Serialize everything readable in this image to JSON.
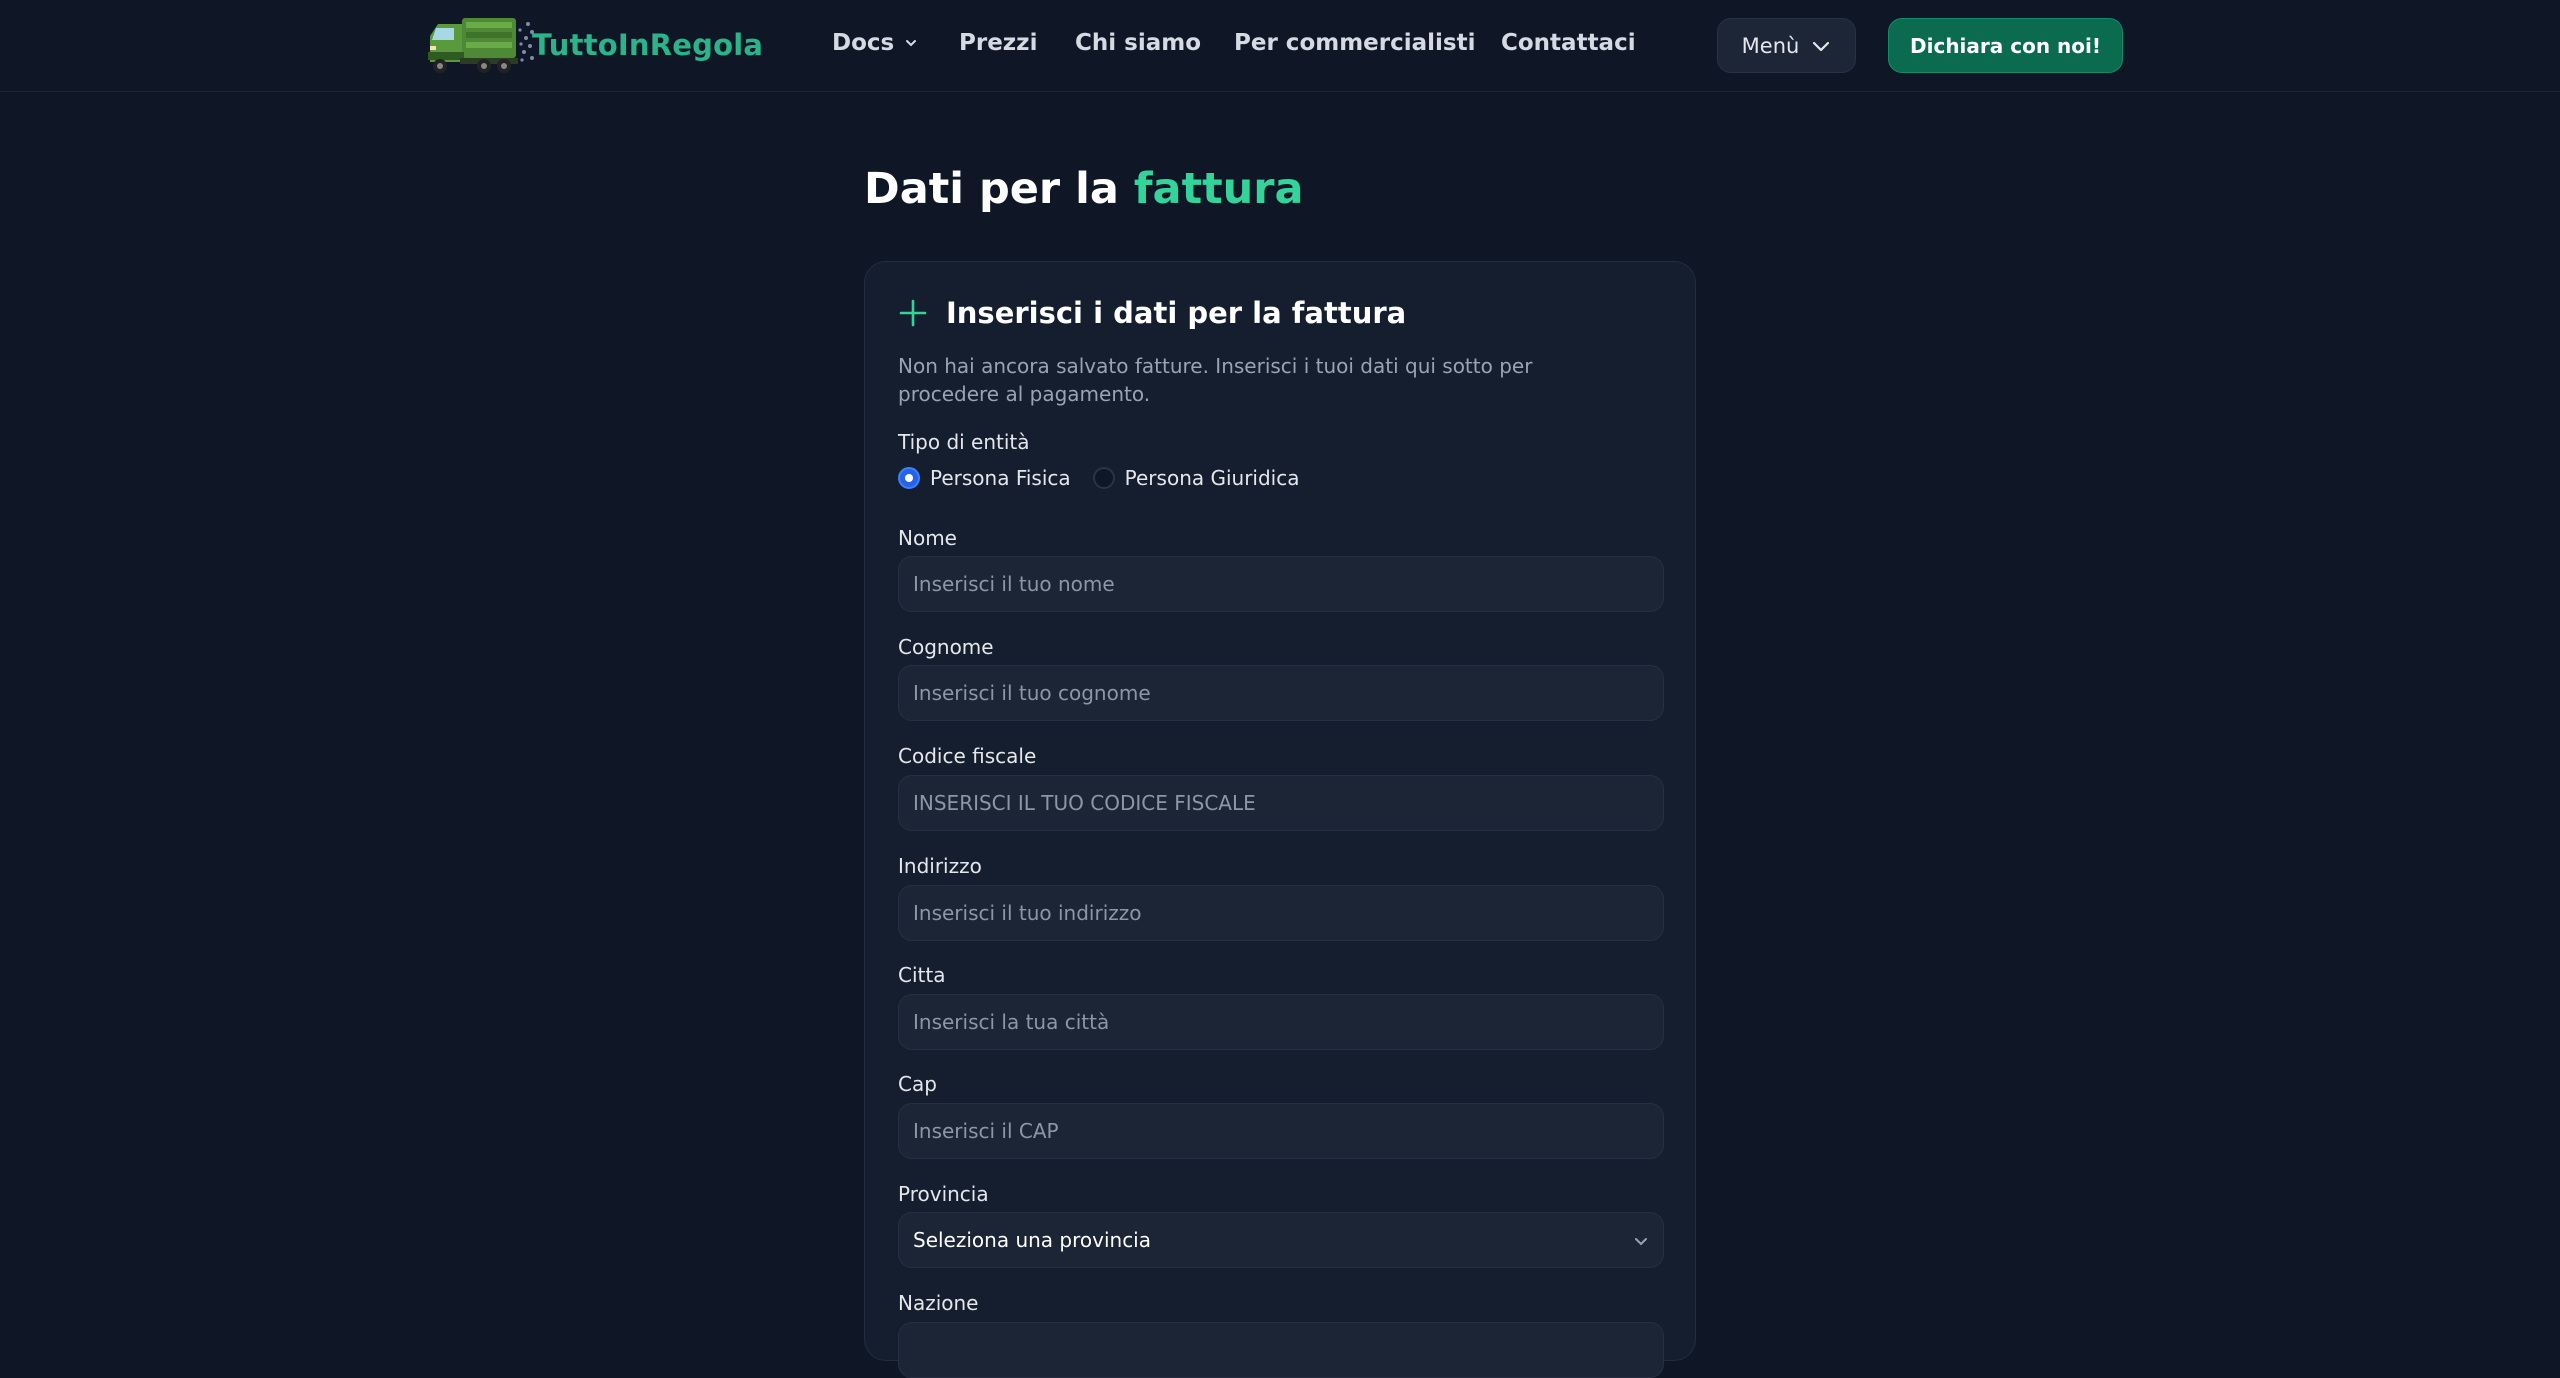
{
  "brand": {
    "name": "TuttoInRegola"
  },
  "nav": {
    "docs": "Docs",
    "prezzi": "Prezzi",
    "chi_siamo": "Chi siamo",
    "commercialisti": "Per commercialisti",
    "contattaci": "Contattaci"
  },
  "header": {
    "menu_label": "Menù",
    "cta_label": "Dichiara con noi!"
  },
  "page": {
    "title_prefix": "Dati per la",
    "title_accent": "fattura"
  },
  "card": {
    "title": "Inserisci i dati per la fattura",
    "description": "Non hai ancora salvato fatture. Inserisci i tuoi dati qui sotto per procedere al pagamento."
  },
  "form": {
    "entity_label": "Tipo di entità",
    "entity_options": [
      "Persona Fisica",
      "Persona Giuridica"
    ],
    "entity_selected": "Persona Fisica",
    "nome": {
      "label": "Nome",
      "placeholder": "Inserisci il tuo nome",
      "value": ""
    },
    "cognome": {
      "label": "Cognome",
      "placeholder": "Inserisci il tuo cognome",
      "value": ""
    },
    "codice_fiscale": {
      "label": "Codice fiscale",
      "placeholder": "INSERISCI IL TUO CODICE FISCALE",
      "value": ""
    },
    "indirizzo": {
      "label": "Indirizzo",
      "placeholder": "Inserisci il tuo indirizzo",
      "value": ""
    },
    "citta": {
      "label": "Citta",
      "placeholder": "Inserisci la tua città",
      "value": ""
    },
    "cap": {
      "label": "Cap",
      "placeholder": "Inserisci il CAP",
      "value": ""
    },
    "provincia": {
      "label": "Provincia",
      "selected": "Seleziona una provincia"
    },
    "nazione": {
      "label": "Nazione"
    }
  },
  "colors": {
    "background": "#0f1727",
    "card": "#141e2e",
    "accent": "#34d399",
    "brand_green": "#2bb489",
    "cta": "#0b6b4f",
    "radio_checked": "#2563eb"
  },
  "icons": {
    "logo": "green-truck-logo",
    "docs_chevron": "chevron-down-icon",
    "menu_chevron": "chevron-down-icon",
    "card_icon": "plus-icon",
    "select_chevron": "chevron-down-icon"
  }
}
